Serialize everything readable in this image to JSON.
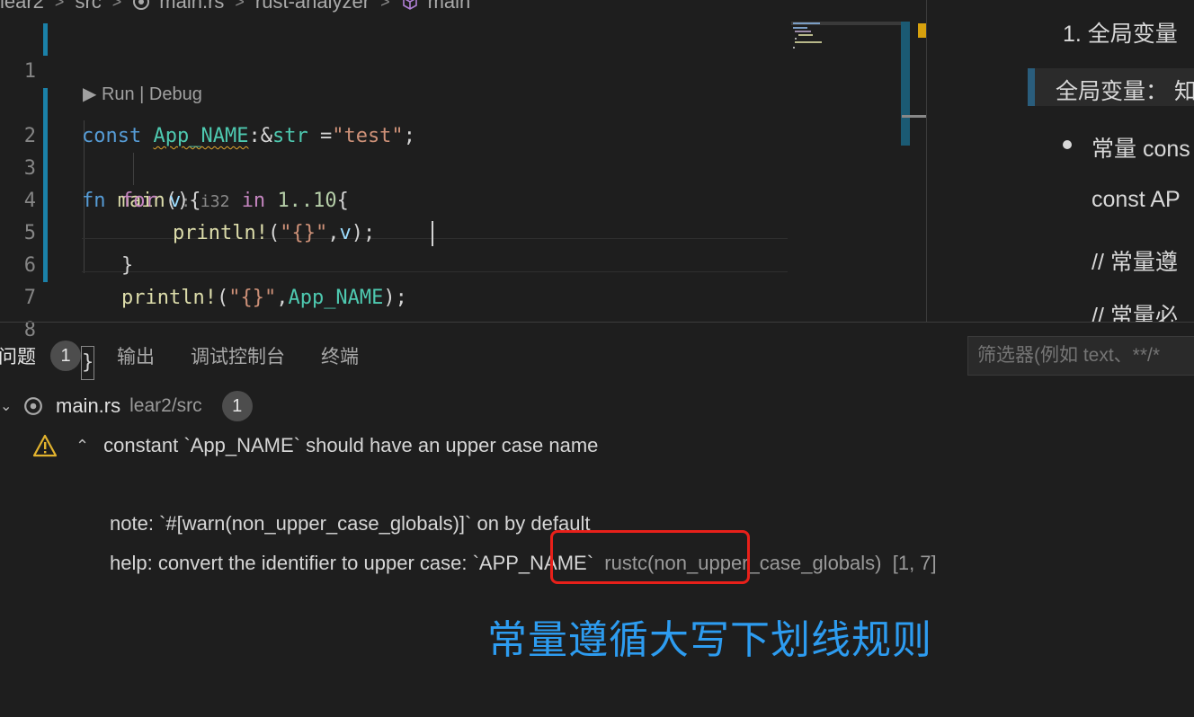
{
  "breadcrumb": {
    "items": [
      "lear2",
      "src",
      "main.rs",
      "rust-analyzer",
      "main"
    ]
  },
  "editor": {
    "codelens": "▶ Run | Debug",
    "line_numbers": [
      "1",
      "2",
      "3",
      "4",
      "5",
      "6",
      "7",
      "8"
    ],
    "lines": {
      "l1": {
        "kw": "const",
        "name": "App_NAME",
        "sep": ":&",
        "type": "str",
        "eq": " =",
        "str": "\"test\"",
        "end": ";"
      },
      "l2": {
        "kw": "fn",
        "name": "main",
        "rest": "(){"
      },
      "l3": {
        "kw": "for",
        "var": "v",
        "hint": ": i32",
        "in": "in",
        "range": "1..10",
        "end": "{"
      },
      "l4": {
        "mac": "println!",
        "open": "(",
        "str": "\"{}\"",
        "comma": ",",
        "var": "v",
        "end": ");"
      },
      "l5": {
        "text": "}"
      },
      "l6": {
        "mac": "println!",
        "open": "(",
        "str": "\"{}\"",
        "comma": ",",
        "var": "App_NAME",
        "end": ");"
      },
      "l8": {
        "text": "}"
      }
    }
  },
  "right_panel": {
    "heading": "1. 全局变量",
    "quote": "全局变量：  知",
    "bullet": "常量 cons",
    "line1": "const AP",
    "line2": "// 常量遵",
    "line3": "// 常量必"
  },
  "panel": {
    "tabs": [
      {
        "label": "问题",
        "badge": "1"
      },
      {
        "label": "输出"
      },
      {
        "label": "调试控制台"
      },
      {
        "label": "终端"
      }
    ],
    "filter_placeholder": "筛选器(例如 text、**/*"
  },
  "problems": {
    "file": {
      "name": "main.rs",
      "path": "lear2/src",
      "count": "1"
    },
    "message": "constant `App_NAME` should have an upper case name",
    "note": "note: `#[warn(non_upper_case_globals)]` on by default",
    "help_prefix": "help: convert the identifier to upper case: ",
    "help_suggestion": "`APP_NAME`",
    "source": "rustc(non_upper_case_globals)",
    "position": "[1, 7]"
  },
  "annotation": "常量遵循大写下划线规则",
  "colors": {
    "accent": "#2d9cf0",
    "highlight": "#e8201a",
    "warning": "#e2a72e"
  }
}
